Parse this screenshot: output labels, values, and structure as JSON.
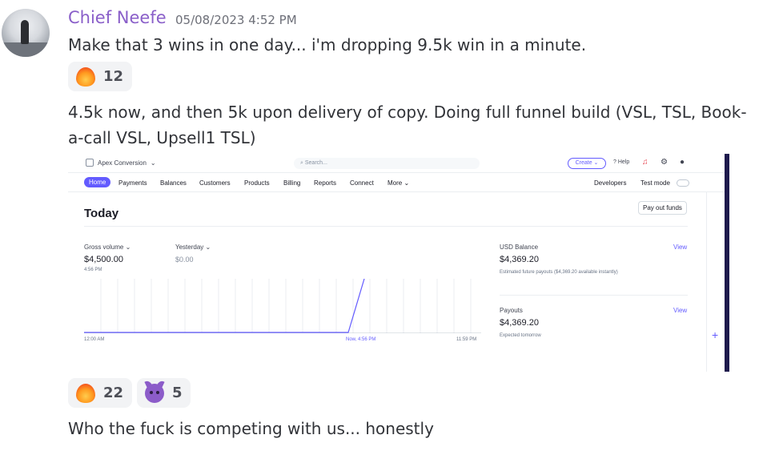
{
  "post": {
    "author": "Chief Neefe",
    "timestamp": "05/08/2023 4:52 PM",
    "message1": "Make that 3 wins in one day... i'm dropping 9.5k win in a minute.",
    "reaction1": {
      "emoji": "fire",
      "count": "12"
    },
    "message2": "4.5k now, and then 5k upon delivery of copy. Doing full funnel build (VSL, TSL, Book-a-call VSL, Upsell1 TSL)",
    "reactions2": [
      {
        "emoji": "fire",
        "count": "22"
      },
      {
        "emoji": "smiling-devil",
        "count": "5"
      }
    ],
    "message3": "Who the fuck is competing with us... honestly"
  },
  "embed": {
    "account": "Apex Conversion",
    "search_placeholder": "Search...",
    "create_label": "Create",
    "help_label": "Help",
    "nav": [
      "Home",
      "Payments",
      "Balances",
      "Customers",
      "Products",
      "Billing",
      "Reports",
      "Connect",
      "More"
    ],
    "developers": "Developers",
    "test_mode": "Test mode",
    "page_title": "Today",
    "payout_button": "Pay out funds",
    "gross_volume_label": "Gross volume",
    "gross_volume_value": "$4,500.00",
    "gross_volume_time": "4:56 PM",
    "yesterday_label": "Yesterday",
    "yesterday_value": "$0.00",
    "usd_balance_label": "USD Balance",
    "usd_balance_value": "$4,369.20",
    "usd_balance_note": "Estimated future payouts ($4,369.20 available instantly)",
    "payouts_label": "Payouts",
    "payouts_value": "$4,369.20",
    "payouts_note": "Expected tomorrow",
    "view_label": "View",
    "chart_start": "12:00 AM",
    "chart_now": "Now, 4:56 PM",
    "chart_end": "11:59 PM",
    "accent": "#635bff"
  }
}
